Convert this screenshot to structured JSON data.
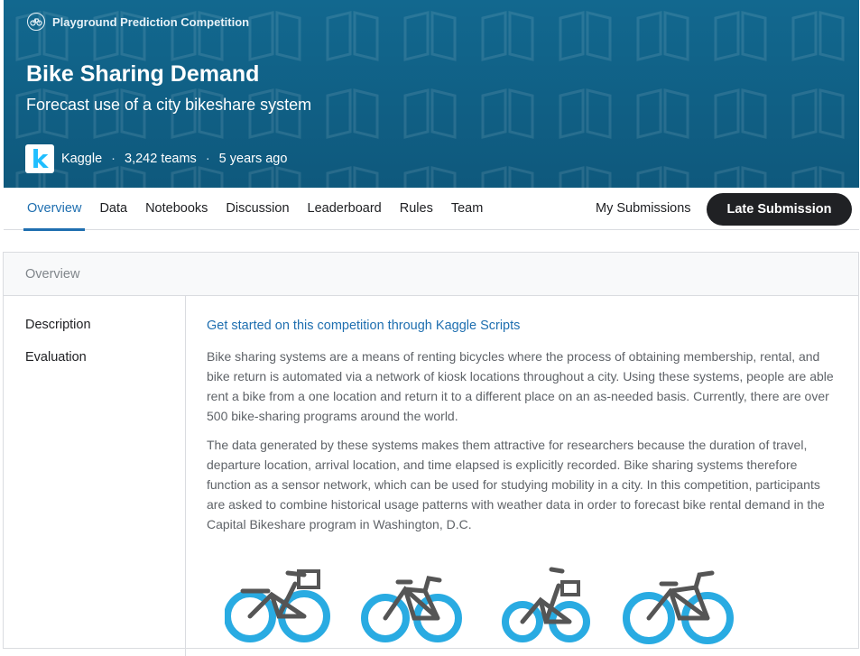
{
  "header": {
    "competition_type": "Playground Prediction Competition",
    "title": "Bike Sharing Demand",
    "subtitle": "Forecast use of a city bikeshare system",
    "host_logo_letter": "k",
    "host": "Kaggle",
    "teams": "3,242 teams",
    "age": "5 years ago",
    "separator": "·",
    "colors": {
      "banner": "#12688f",
      "accent": "#1f6fb0"
    }
  },
  "tabs": [
    {
      "label": "Overview",
      "active": true
    },
    {
      "label": "Data"
    },
    {
      "label": "Notebooks"
    },
    {
      "label": "Discussion"
    },
    {
      "label": "Leaderboard"
    },
    {
      "label": "Rules"
    },
    {
      "label": "Team"
    }
  ],
  "actions": {
    "my_submissions": "My Submissions",
    "late_submission": "Late Submission"
  },
  "overview": {
    "header": "Overview",
    "sidebar": [
      "Description",
      "Evaluation"
    ],
    "link": "Get started on this competition through Kaggle Scripts",
    "paragraphs": [
      "Bike sharing systems are a means of renting bicycles where the process of obtaining membership, rental, and bike return is automated via a network of kiosk locations throughout a city. Using these systems, people are able rent a bike from a one location and return it to a different place on an as-needed basis. Currently, there are over 500 bike-sharing programs around the world.",
      "The data generated by these systems makes them attractive for researchers because the duration of travel, departure location, arrival location, and time elapsed is explicitly recorded. Bike sharing systems therefore function as a sensor network, which can be used for studying mobility in a city. In this competition, participants are asked to combine historical usage patterns with weather data in order to forecast bike rental demand in the Capital Bikeshare program in Washington, D.C."
    ]
  },
  "icons": [
    "bike-circle-icon",
    "bike-illustration-icon"
  ]
}
